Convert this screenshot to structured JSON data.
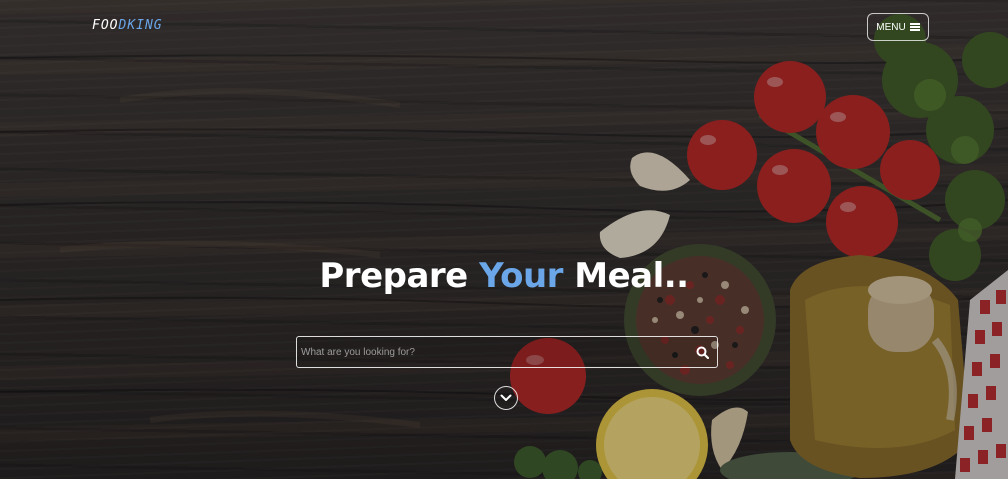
{
  "header": {
    "logo_part1": "FOO",
    "logo_part2": "D",
    "logo_part3": "KING",
    "menu_label": "MENU"
  },
  "hero": {
    "headline_part1": "Prepare ",
    "headline_accent": "Your",
    "headline_part2": " Meal.."
  },
  "search": {
    "placeholder": "What are you looking for?",
    "value": ""
  },
  "icons": {
    "menu": "hamburger-icon",
    "search": "search-icon",
    "scroll": "chevron-down-icon"
  },
  "colors": {
    "accent": "#6aa6e8",
    "text": "#ffffff"
  }
}
